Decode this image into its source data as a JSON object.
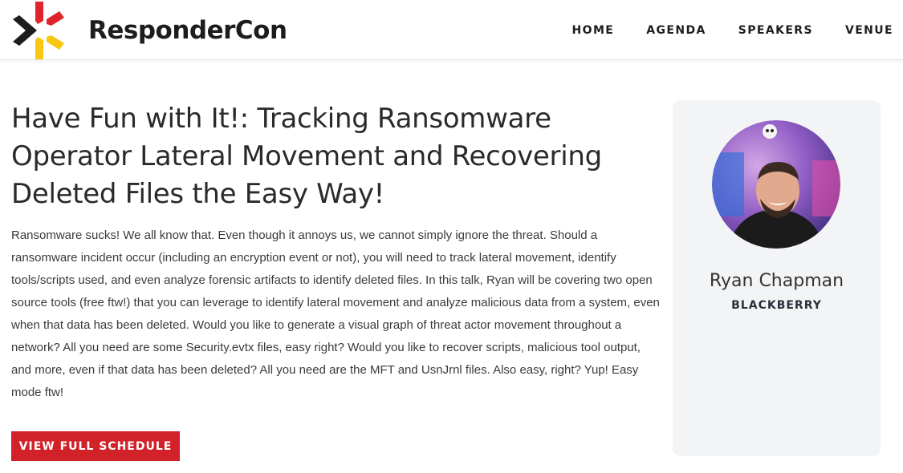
{
  "brand": {
    "name": "ResponderCon",
    "logo_colors": {
      "red": "#e0242b",
      "black": "#1d1d1d",
      "yellow": "#f7c713"
    }
  },
  "nav": {
    "items": [
      {
        "label": "HOME"
      },
      {
        "label": "AGENDA"
      },
      {
        "label": "SPEAKERS"
      },
      {
        "label": "VENUE"
      }
    ]
  },
  "talk": {
    "title": "Have Fun with It!: Tracking Ransomware Operator Lateral Movement and Recovering Deleted Files the Easy Way!",
    "abstract": "Ransomware sucks! We all know that. Even though it annoys us, we cannot simply ignore the threat. Should a ransomware incident occur (including an encryption event or not), you will need to track lateral movement, identify tools/scripts used, and even analyze forensic artifacts to identify deleted files. In this talk, Ryan will be covering two open source tools (free ftw!) that you can leverage to identify lateral movement and analyze malicious data from a system, even when that data has been deleted. Would you like to generate a visual graph of threat actor movement throughout a network? All you need are some Security.evtx files, easy right? Would you like to recover scripts, malicious tool output, and more, even if that data has been deleted? All you need are the MFT and UsnJrnl files. Also easy, right? Yup! Easy mode ftw!",
    "button_label": "VIEW FULL SCHEDULE",
    "accent_color": "#d1222a"
  },
  "speaker": {
    "name": "Ryan Chapman",
    "company": "BLACKBERRY",
    "avatar_icon": "speaker-photo"
  }
}
